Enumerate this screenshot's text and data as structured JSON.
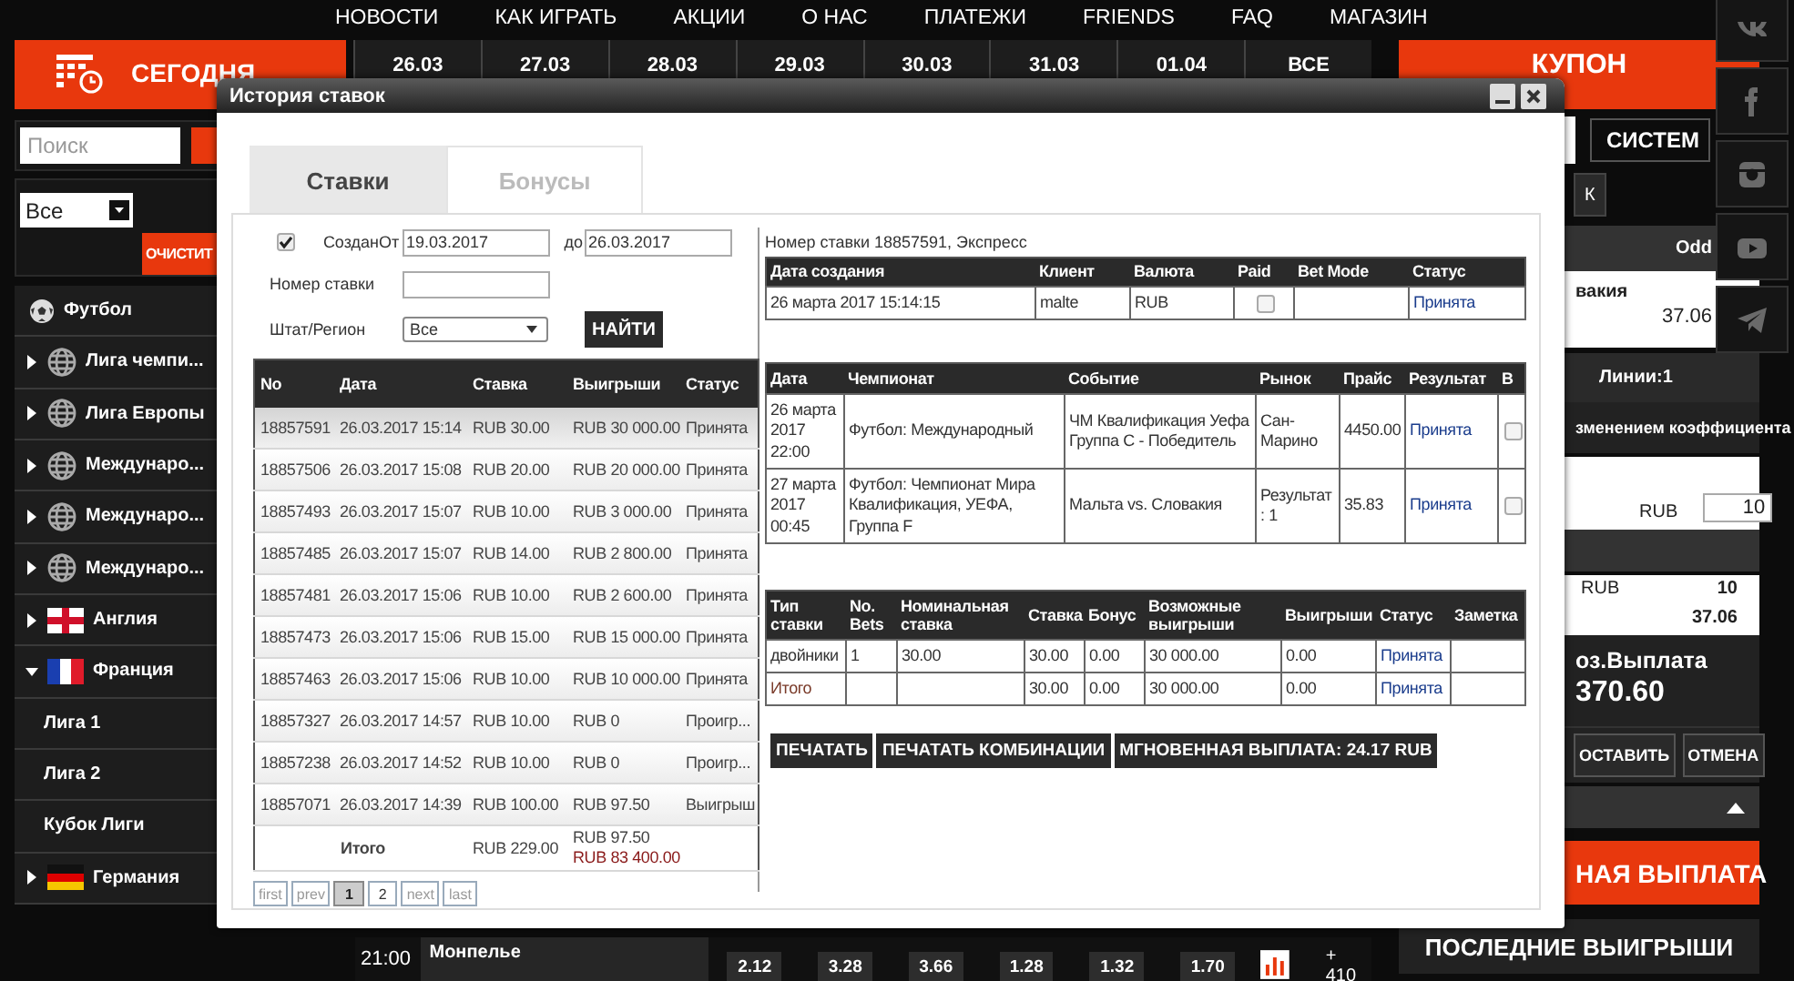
{
  "top_nav": [
    "НОВОСТИ",
    "КАК ИГРАТЬ",
    "АКЦИИ",
    "О НАС",
    "ПЛАТЕЖИ",
    "FRIENDS",
    "FAQ",
    "МАГАЗИН"
  ],
  "date_strip": {
    "today": "СЕГОДНЯ",
    "dates": [
      "26.03",
      "27.03",
      "28.03",
      "29.03",
      "30.03",
      "31.03",
      "01.04"
    ],
    "all": "ВСЕ"
  },
  "sidebar": {
    "search": {
      "placeholder": "Поиск"
    },
    "filter": "Все",
    "clear_button": "ОЧИСТИТ",
    "items": [
      {
        "label": "Футбол",
        "kind": "ball"
      },
      {
        "label": "Лига чемпи...",
        "kind": "globe",
        "expanded": false
      },
      {
        "label": "Лига Европы",
        "kind": "globe",
        "expanded": false
      },
      {
        "label": "Междунаро...",
        "kind": "globe",
        "expanded": false
      },
      {
        "label": "Междунаро...",
        "kind": "globe",
        "expanded": false
      },
      {
        "label": "Междунаро...",
        "kind": "globe",
        "expanded": false
      },
      {
        "label": "Англия",
        "kind": "england",
        "expanded": false
      },
      {
        "label": "Франция",
        "kind": "france",
        "expanded": true,
        "children": [
          {
            "label": "Лига 1"
          },
          {
            "label": "Лига 2"
          },
          {
            "label": "Кубок Лиги"
          }
        ]
      },
      {
        "label": "Германия",
        "kind": "germany",
        "expanded": false
      }
    ]
  },
  "match_row": {
    "time": "21:00",
    "team": "Монпелье",
    "odds": [
      "2.12",
      "3.28",
      "3.66",
      "1.28",
      "1.32",
      "1.70"
    ],
    "more": "+ 410"
  },
  "coupon": {
    "title": "КУПОН",
    "system_button": "СИСТЕМ",
    "ok_button": "К",
    "odd_header": "Odd",
    "event": "вакия",
    "odd": "37.06",
    "lines": "Линии:1",
    "odds_change": "зменением коэффициента",
    "stake_currency": "RUB",
    "stake": "10",
    "sum_currency": "RUB",
    "sum": "10",
    "total_odd": "37.06",
    "payout_label": "оз.Выплата",
    "payout": "370.60",
    "place_button": "ОСТАВИТЬ",
    "cancel_button": "ОТМЕНА",
    "instant_payout": "НАЯ ВЫПЛАТА",
    "last_wins": "ПОСЛЕДНИЕ ВЫИГРЫШИ"
  },
  "social": [
    {
      "kind": "vk"
    },
    {
      "kind": "facebook"
    },
    {
      "kind": "instagram"
    },
    {
      "kind": "youtube"
    },
    {
      "kind": "telegram"
    }
  ],
  "dialog": {
    "title": "История ставок",
    "tabs": [
      {
        "label": "Ставки",
        "selected": true
      },
      {
        "label": "Бонусы",
        "selected": false
      }
    ],
    "filter": {
      "created": {
        "label": "Создан",
        "checked": true
      },
      "from_label": "От",
      "from": "19.03.2017",
      "to_label": "до",
      "to": "26.03.2017",
      "bet_number_label": "Номер ставки",
      "region_label": "Штат/Регион",
      "region": "Все",
      "find_button": "НАЙТИ"
    },
    "bets": {
      "columns": [
        "No",
        "Дата",
        "Ставка",
        "Выигрыши",
        "Статус"
      ],
      "rows": [
        {
          "cells": [
            "18857591",
            "26.03.2017 15:14",
            "RUB 30.00",
            "RUB 30 000.00",
            "Принята"
          ],
          "selected": true
        },
        {
          "cells": [
            "18857506",
            "26.03.2017 15:08",
            "RUB 20.00",
            "RUB 20 000.00",
            "Принята"
          ],
          "selected": false
        },
        {
          "cells": [
            "18857493",
            "26.03.2017 15:07",
            "RUB 10.00",
            "RUB 3 000.00",
            "Принята"
          ],
          "selected": false
        },
        {
          "cells": [
            "18857485",
            "26.03.2017 15:07",
            "RUB 14.00",
            "RUB 2 800.00",
            "Принята"
          ],
          "selected": false
        },
        {
          "cells": [
            "18857481",
            "26.03.2017 15:06",
            "RUB 10.00",
            "RUB 2 600.00",
            "Принята"
          ],
          "selected": false
        },
        {
          "cells": [
            "18857473",
            "26.03.2017 15:06",
            "RUB 15.00",
            "RUB 15 000.00",
            "Принята"
          ],
          "selected": false
        },
        {
          "cells": [
            "18857463",
            "26.03.2017 15:06",
            "RUB 10.00",
            "RUB 10 000.00",
            "Принята"
          ],
          "selected": false
        },
        {
          "cells": [
            "18857327",
            "26.03.2017 14:57",
            "RUB 10.00",
            "RUB 0",
            "Проигр..."
          ],
          "selected": false
        },
        {
          "cells": [
            "18857238",
            "26.03.2017 14:52",
            "RUB 10.00",
            "RUB 0",
            "Проигр..."
          ],
          "selected": false
        },
        {
          "cells": [
            "18857071",
            "26.03.2017 14:39",
            "RUB 100.00",
            "RUB 97.50",
            "Выигрыш"
          ],
          "selected": false
        }
      ],
      "total": {
        "label": "Итого",
        "stake": "RUB 229.00",
        "wins": "RUB 97.50",
        "potential": "RUB 83 400.00"
      },
      "pages": [
        {
          "label": "first",
          "selected": false
        },
        {
          "label": "prev",
          "selected": false
        },
        {
          "label": "1",
          "selected": true
        },
        {
          "label": "2",
          "selected": false
        },
        {
          "label": "next",
          "selected": false
        },
        {
          "label": "last",
          "selected": false
        }
      ]
    },
    "detail": {
      "title": "Номер ставки 18857591, Экспресс",
      "summary": {
        "columns": [
          "Дата создания",
          "Клиент",
          "Валюта",
          "Paid",
          "Bet Mode",
          "Статус"
        ],
        "created": "26 марта 2017 15:14:15",
        "client": "malte",
        "currency": "RUB",
        "paid": false,
        "status": "Принята"
      },
      "selections": {
        "columns": [
          "Дата",
          "Чемпионат",
          "Событие",
          "Рынок",
          "Прайс",
          "Результат",
          "B"
        ],
        "rows": [
          {
            "date": "26 марта 2017 22:00",
            "championship": "Футбол: Международный",
            "event": "ЧМ Квалификация Уефа Группа C - Победитель",
            "market": "Сан-Марино",
            "price": "4450.00",
            "result": "Принята",
            "checked": false
          },
          {
            "date": "27 марта 2017 00:45",
            "championship": "Футбол: Чемпионат Мира Квалификация, УЕФА, Группа F",
            "event": "Мальта vs. Словакия",
            "market": "Результат : 1",
            "price": "35.83",
            "result": "Принята",
            "checked": false
          }
        ]
      },
      "bet_types": {
        "columns": [
          "Тип ставки",
          "No. Bets",
          "Номинальная ставка",
          "Ставка",
          "Бонус",
          "Возможные выигрыши",
          "Выигрыши",
          "Статус",
          "Заметка"
        ],
        "rows": [
          {
            "kind": "bet",
            "type": "двойники",
            "bets": "1",
            "nominal": "30.00",
            "stake": "30.00",
            "bonus": "0.00",
            "possible": "30 000.00",
            "wins": "0.00",
            "status": "Принята"
          },
          {
            "kind": "total",
            "type": "Итого",
            "stake": "30.00",
            "bonus": "0.00",
            "possible": "30 000.00",
            "wins": "0.00",
            "status": "Принята"
          }
        ]
      },
      "buttons": [
        "ПЕЧАТАТЬ",
        "ПЕЧАТАТЬ КОМБИНАЦИИ",
        "МГНОВЕННАЯ ВЫПЛАТА: 24.17 RUB"
      ]
    }
  }
}
